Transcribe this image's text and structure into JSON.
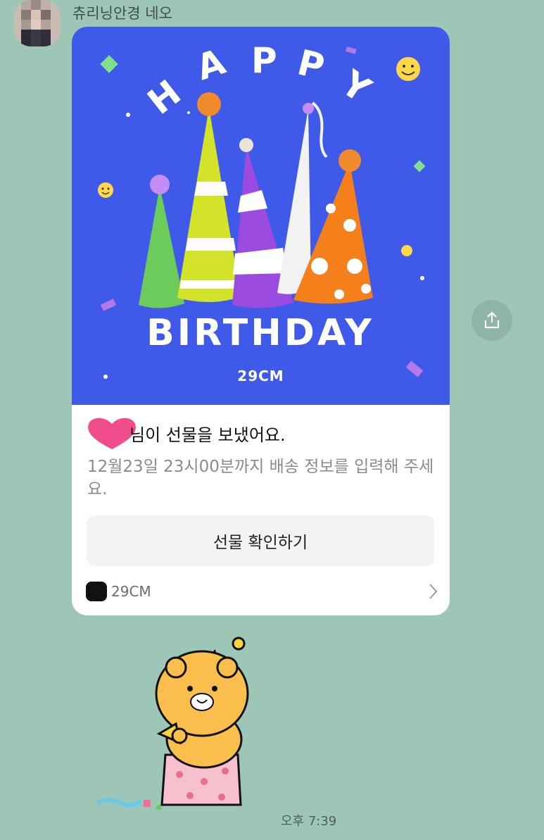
{
  "chat": {
    "sender_name": "츄리닝안경 네오",
    "timestamp": "오후 7:39"
  },
  "card": {
    "banner": {
      "headline_top": "HAPPY",
      "headline_bottom": "BIRTHDAY",
      "brand": "29CM",
      "colors": {
        "background": "#3f5ae8"
      }
    },
    "title": "님이 선물을 보냈어요.",
    "description": "12월23일 23시00분까지 배송 정보를 입력해 주세요.",
    "cta_label": "선물 확인하기",
    "footer_brand": "29CM",
    "icons": {
      "footer_logo": "29cm-logo",
      "chevron": "chevron-right-icon"
    }
  },
  "icons": {
    "share": "share-icon",
    "sticker": "ryan-cat-party-sticker",
    "avatar": "blurred-profile-avatar",
    "heart": "heart-censor"
  }
}
